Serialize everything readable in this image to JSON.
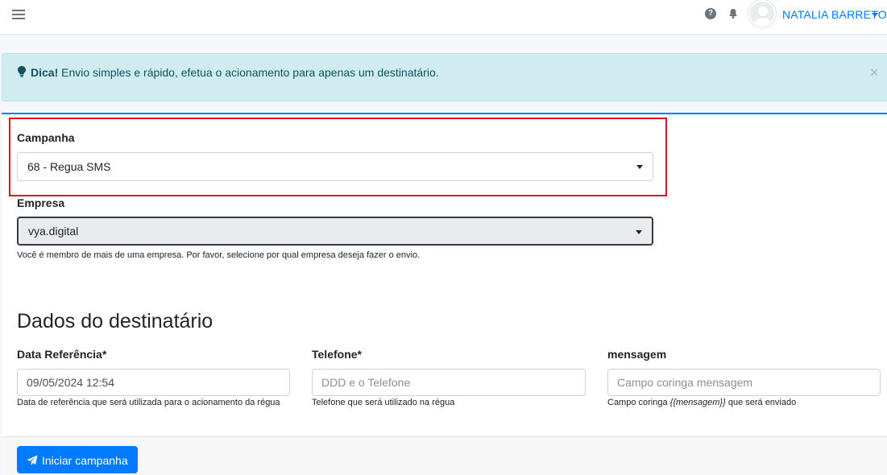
{
  "header": {
    "user_name": "NATALIA BARRETO",
    "icons": [
      "menu-icon",
      "help-icon",
      "bell-icon",
      "avatar"
    ]
  },
  "alert": {
    "strong": "Dica!",
    "message": " Envio simples e rápido, efetua o acionamento para apenas um destinatário.",
    "close": "×"
  },
  "campaign": {
    "label": "Campanha",
    "value": "68 - Regua SMS"
  },
  "company": {
    "label": "Empresa",
    "value": "vya.digital",
    "help": "Você é membro de mais de uma empresa. Por favor, selecione por qual empresa deseja fazer o envio."
  },
  "recipient": {
    "title": "Dados do destinatário",
    "date": {
      "label": "Data Referência*",
      "value": "09/05/2024 12:54",
      "help": "Data de referência que será utilizada para o acionamento da régua"
    },
    "phone": {
      "label": "Telefone*",
      "placeholder": "DDD e o Telefone",
      "help": "Telefone que será utilizado na régua"
    },
    "message": {
      "label": "mensagem",
      "placeholder": "Campo coringa mensagem",
      "help_prefix": "Campo coringa ",
      "help_var": "{{mensagem}}",
      "help_suffix": " que será enviado"
    }
  },
  "actions": {
    "submit_label": "Iniciar campanha"
  },
  "colors": {
    "primary": "#007bff",
    "alert_bg": "#d1ecf1",
    "highlight": "#e0151b"
  }
}
